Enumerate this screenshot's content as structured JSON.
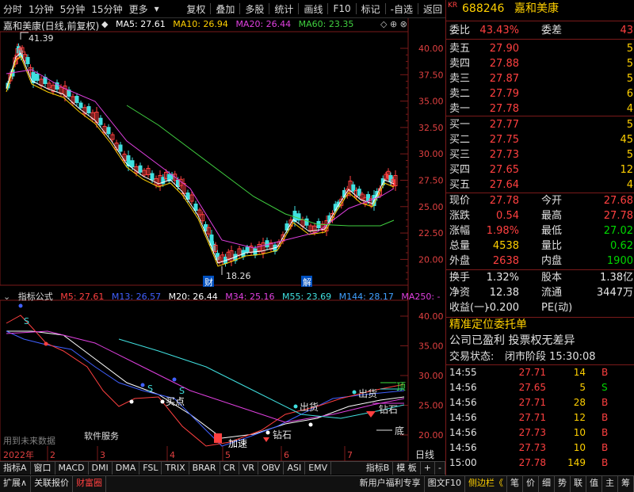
{
  "toolbar": {
    "left": [
      "分时",
      "1分钟",
      "5分钟",
      "15分钟",
      "更多"
    ],
    "right": [
      "复权",
      "叠加",
      "多股",
      "统计",
      "画线",
      "F10",
      "标记",
      "-自选",
      "返回"
    ]
  },
  "stock": {
    "title": "嘉和美康(日线,前复权)",
    "code_prefix": "KR",
    "code": "688246",
    "name": "嘉和美康"
  },
  "ma_legend": [
    {
      "label": "MA5: 27.61",
      "color": "#ffffff"
    },
    {
      "label": "MA10: 26.94",
      "color": "#ffd000"
    },
    {
      "label": "MA20: 26.44",
      "color": "#e040e0"
    },
    {
      "label": "MA60: 23.35",
      "color": "#40d040"
    }
  ],
  "upper_axis": [
    "40.00",
    "37.50",
    "35.00",
    "32.50",
    "30.00",
    "27.50",
    "25.00",
    "22.50",
    "20.00"
  ],
  "annotations": {
    "high": "41.39",
    "low": "18.26",
    "cai": "财",
    "jie": "解"
  },
  "lower_legend": [
    {
      "label": "指标公式",
      "color": "#e0e0e0"
    },
    {
      "label": "M5: 27.61",
      "color": "#ff4040"
    },
    {
      "label": "M13: 26.57",
      "color": "#4060ff"
    },
    {
      "label": "M20: 26.44",
      "color": "#ffffff"
    },
    {
      "label": "M34: 25.16",
      "color": "#e040e0"
    },
    {
      "label": "M55: 23.69",
      "color": "#40e0e0"
    },
    {
      "label": "M144: 28.17",
      "color": "#40a0ff"
    },
    {
      "label": "MA250: -",
      "color": "#e040e0"
    }
  ],
  "lower_axis": [
    "40.00",
    "35.00",
    "30.00",
    "25.00",
    "20.00"
  ],
  "lower_texts": {
    "maidian": "买点",
    "chuhuo1": "出货",
    "chuhuo2": "出货",
    "zuanshi1": "钻石",
    "zuanshi2": "钻石",
    "fengding": "顶",
    "di": "底",
    "jiasu": "加速",
    "future": "用到未来数据",
    "service": "软件服务",
    "s": "S"
  },
  "x_axis": [
    "2022年",
    "2",
    "3",
    "4",
    "5",
    "6",
    "7",
    "日线"
  ],
  "tabs1": [
    "指标A",
    "窗口",
    "MACD",
    "DMI",
    "DMA",
    "FSL",
    "TRIX",
    "BRAR",
    "CR",
    "VR",
    "OBV",
    "ASI",
    "EMV",
    "指标B",
    "模 板",
    "+",
    "-"
  ],
  "tabs2": [
    "扩展∧",
    "关联报价",
    "财富圈",
    "新用户福利专享",
    "图文F10",
    "侧边栏《",
    "笔",
    "价",
    "细",
    "势",
    "联",
    "值",
    "主",
    "筹"
  ],
  "quote": {
    "weibi_label": "委比",
    "weibi": "43.43%",
    "weicha_label": "委差",
    "weicha": "43",
    "asks": [
      {
        "label": "卖五",
        "price": "27.90",
        "vol": "5"
      },
      {
        "label": "卖四",
        "price": "27.88",
        "vol": "5"
      },
      {
        "label": "卖三",
        "price": "27.87",
        "vol": "5"
      },
      {
        "label": "卖二",
        "price": "27.79",
        "vol": "6"
      },
      {
        "label": "卖一",
        "price": "27.78",
        "vol": "4"
      }
    ],
    "bids": [
      {
        "label": "买一",
        "price": "27.77",
        "vol": "5"
      },
      {
        "label": "买二",
        "price": "27.75",
        "vol": "45"
      },
      {
        "label": "买三",
        "price": "27.73",
        "vol": "5"
      },
      {
        "label": "买四",
        "price": "27.65",
        "vol": "12"
      },
      {
        "label": "买五",
        "price": "27.64",
        "vol": "4"
      }
    ],
    "stats": [
      {
        "l1": "现价",
        "v1": "27.78",
        "c1": "red",
        "l2": "今开",
        "v2": "27.68",
        "c2": "red"
      },
      {
        "l1": "涨跌",
        "v1": "0.54",
        "c1": "red",
        "l2": "最高",
        "v2": "27.78",
        "c2": "red"
      },
      {
        "l1": "涨幅",
        "v1": "1.98%",
        "c1": "red",
        "l2": "最低",
        "v2": "27.02",
        "c2": "green"
      },
      {
        "l1": "总量",
        "v1": "4538",
        "c1": "yel",
        "l2": "量比",
        "v2": "0.62",
        "c2": "green"
      },
      {
        "l1": "外盘",
        "v1": "2638",
        "c1": "red",
        "l2": "内盘",
        "v2": "1900",
        "c2": "green"
      }
    ],
    "stats2": [
      {
        "l1": "换手",
        "v1": "1.32%",
        "l2": "股本",
        "v2": "1.38亿"
      },
      {
        "l1": "净资",
        "v1": "12.38",
        "l2": "流通",
        "v2": "3447万"
      },
      {
        "l1": "收益(一)",
        "v1": "-0.200",
        "l2": "PE(动)",
        "v2": ""
      }
    ],
    "entrust": "精准定位委托单",
    "profit": "公司已盈利 投票权无差异",
    "status_label": "交易状态:",
    "status": "闭市阶段 15:30:08"
  },
  "ticks": [
    {
      "t": "14:55",
      "p": "27.71",
      "v": "14",
      "d": "B"
    },
    {
      "t": "14:56",
      "p": "27.65",
      "v": "5",
      "d": "S"
    },
    {
      "t": "14:56",
      "p": "27.71",
      "v": "28",
      "d": "B"
    },
    {
      "t": "14:56",
      "p": "27.71",
      "v": "12",
      "d": "B"
    },
    {
      "t": "14:56",
      "p": "27.73",
      "v": "10",
      "d": "B"
    },
    {
      "t": "14:56",
      "p": "27.73",
      "v": "10",
      "d": "B"
    },
    {
      "t": "15:00",
      "p": "27.78",
      "v": "149",
      "d": "B"
    }
  ],
  "colors": {
    "up": "#ff4040",
    "down": "#00d800",
    "accent": "#ffd000",
    "border": "#7a1a1a"
  }
}
